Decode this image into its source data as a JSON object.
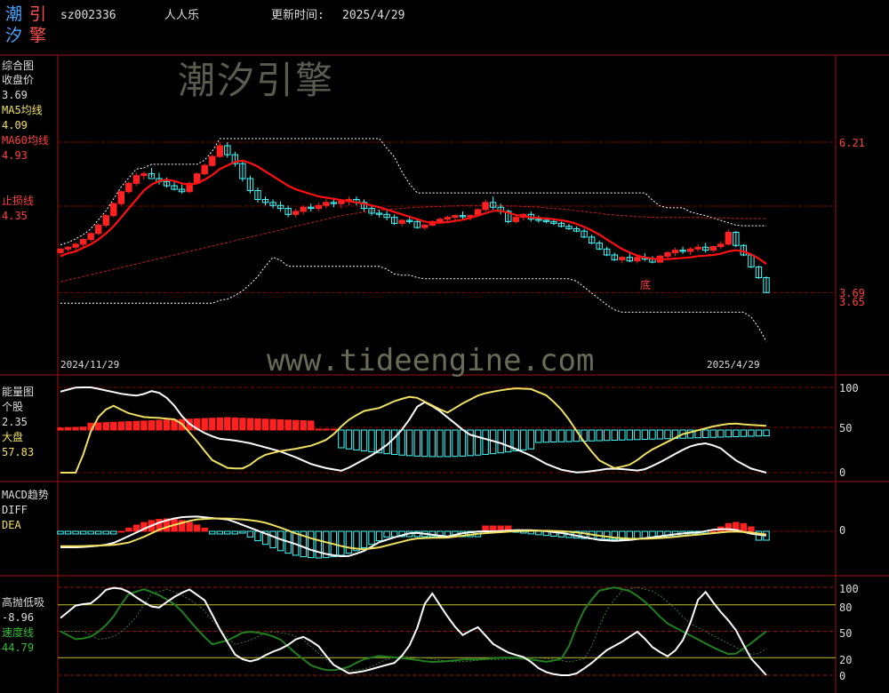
{
  "header": {
    "logo_chars": [
      "潮",
      "引",
      "汐",
      "擎"
    ],
    "code": "sz002336",
    "name": "人人乐",
    "update_label": "更新时间:",
    "update_date": "2025/4/29"
  },
  "watermarks": {
    "cn": "潮汐引擎",
    "url": "www.tideengine.com"
  },
  "colors": {
    "up": "#ff2020",
    "down": "#40ffff",
    "ma5": "#ff1010",
    "grid": "#8b0000",
    "yellow": "#f0e060",
    "white": "#ffffff",
    "green": "#208020"
  },
  "main_panel": {
    "title": "综合图",
    "close_label": "收盘价",
    "close_value": "3.69",
    "ma5_label": "MA5均线",
    "ma5_value": "4.09",
    "ma60_label": "MA60均线",
    "ma60_value": "4.93",
    "stop_label": "止损线",
    "stop_value": "4.35",
    "right_label_top": "6.21",
    "right_label_mid": "3.69",
    "right_label_low": "3.65",
    "start_date": "2024/11/29",
    "end_date": "2025/4/29",
    "bottom_mark": "底"
  },
  "energy_panel": {
    "title": "能量图",
    "stock_label": "个股",
    "stock_value": "2.35",
    "market_label": "大盘",
    "market_value": "57.83",
    "ticks": [
      "100",
      "50",
      "0"
    ]
  },
  "macd_panel": {
    "title": "MACD趋势",
    "diff_label": "DIFF",
    "dea_label": "DEA",
    "tick": "0"
  },
  "hl_panel": {
    "title": "高抛低吸",
    "value": "-8.96",
    "speed_label": "速度线",
    "speed_value": "44.79",
    "ticks": [
      "100",
      "80",
      "50",
      "20",
      "0"
    ]
  },
  "chart_data": {
    "type": "candlestick",
    "x_start": "2024/11/29",
    "x_end": "2025/4/29",
    "y_range": [
      3.65,
      6.21
    ],
    "candles": [
      [
        4.36,
        4.43,
        4.33,
        4.42
      ],
      [
        4.42,
        4.47,
        4.38,
        4.45
      ],
      [
        4.45,
        4.53,
        4.4,
        4.5
      ],
      [
        4.5,
        4.6,
        4.46,
        4.58
      ],
      [
        4.58,
        4.7,
        4.54,
        4.68
      ],
      [
        4.68,
        4.85,
        4.65,
        4.82
      ],
      [
        4.82,
        5.0,
        4.78,
        4.98
      ],
      [
        4.98,
        5.2,
        4.95,
        5.18
      ],
      [
        5.18,
        5.4,
        5.15,
        5.38
      ],
      [
        5.38,
        5.55,
        5.35,
        5.52
      ],
      [
        5.52,
        5.7,
        5.48,
        5.65
      ],
      [
        5.65,
        5.72,
        5.58,
        5.68
      ],
      [
        5.68,
        5.78,
        5.62,
        5.6
      ],
      [
        5.6,
        5.7,
        5.5,
        5.55
      ],
      [
        5.55,
        5.62,
        5.45,
        5.48
      ],
      [
        5.48,
        5.55,
        5.4,
        5.42
      ],
      [
        5.42,
        5.5,
        5.35,
        5.38
      ],
      [
        5.38,
        5.55,
        5.36,
        5.52
      ],
      [
        5.52,
        5.7,
        5.5,
        5.68
      ],
      [
        5.68,
        5.85,
        5.65,
        5.82
      ],
      [
        5.82,
        6.0,
        5.8,
        5.97
      ],
      [
        5.97,
        6.21,
        5.95,
        6.15
      ],
      [
        6.15,
        6.21,
        5.95,
        6.0
      ],
      [
        6.0,
        6.05,
        5.8,
        5.85
      ],
      [
        5.85,
        5.9,
        5.55,
        5.6
      ],
      [
        5.6,
        5.65,
        5.35,
        5.4
      ],
      [
        5.4,
        5.45,
        5.2,
        5.25
      ],
      [
        5.25,
        5.3,
        5.15,
        5.2
      ],
      [
        5.2,
        5.25,
        5.1,
        5.15
      ],
      [
        5.15,
        5.22,
        5.05,
        5.1
      ],
      [
        5.1,
        5.15,
        4.95,
        5.0
      ],
      [
        5.0,
        5.1,
        4.95,
        5.05
      ],
      [
        5.05,
        5.15,
        5.0,
        5.12
      ],
      [
        5.12,
        5.18,
        5.05,
        5.1
      ],
      [
        5.1,
        5.2,
        5.05,
        5.15
      ],
      [
        5.15,
        5.25,
        5.1,
        5.2
      ],
      [
        5.2,
        5.28,
        5.12,
        5.18
      ],
      [
        5.18,
        5.25,
        5.1,
        5.22
      ],
      [
        5.22,
        5.3,
        5.15,
        5.25
      ],
      [
        5.25,
        5.3,
        5.15,
        5.2
      ],
      [
        5.2,
        5.25,
        5.05,
        5.1
      ],
      [
        5.1,
        5.15,
        4.98,
        5.02
      ],
      [
        5.02,
        5.08,
        4.95,
        5.0
      ],
      [
        5.0,
        5.06,
        4.9,
        4.95
      ],
      [
        4.95,
        5.0,
        4.82,
        4.85
      ],
      [
        4.85,
        4.92,
        4.8,
        4.9
      ],
      [
        4.9,
        4.96,
        4.84,
        4.88
      ],
      [
        4.88,
        4.92,
        4.76,
        4.78
      ],
      [
        4.78,
        4.84,
        4.74,
        4.82
      ],
      [
        4.82,
        4.9,
        4.8,
        4.88
      ],
      [
        4.88,
        4.95,
        4.84,
        4.92
      ],
      [
        4.92,
        4.98,
        4.88,
        4.95
      ],
      [
        4.95,
        5.0,
        4.9,
        4.98
      ],
      [
        4.98,
        5.05,
        4.92,
        4.96
      ],
      [
        4.96,
        5.0,
        4.9,
        4.98
      ],
      [
        4.98,
        5.1,
        4.96,
        5.08
      ],
      [
        5.08,
        5.25,
        5.05,
        5.2
      ],
      [
        5.2,
        5.3,
        5.08,
        5.12
      ],
      [
        5.12,
        5.18,
        5.0,
        5.05
      ],
      [
        5.05,
        5.08,
        4.85,
        4.88
      ],
      [
        4.88,
        4.98,
        4.85,
        4.95
      ],
      [
        4.95,
        5.02,
        4.9,
        5.0
      ],
      [
        5.0,
        5.05,
        4.88,
        4.92
      ],
      [
        4.92,
        4.98,
        4.86,
        4.9
      ],
      [
        4.9,
        4.95,
        4.85,
        4.88
      ],
      [
        4.88,
        4.92,
        4.82,
        4.85
      ],
      [
        4.85,
        4.88,
        4.78,
        4.8
      ],
      [
        4.8,
        4.84,
        4.74,
        4.76
      ],
      [
        4.76,
        4.8,
        4.7,
        4.72
      ],
      [
        4.72,
        4.76,
        4.6,
        4.62
      ],
      [
        4.62,
        4.66,
        4.5,
        4.52
      ],
      [
        4.52,
        4.56,
        4.4,
        4.42
      ],
      [
        4.42,
        4.46,
        4.3,
        4.32
      ],
      [
        4.32,
        4.36,
        4.22,
        4.24
      ],
      [
        4.24,
        4.3,
        4.18,
        4.28
      ],
      [
        4.28,
        4.35,
        4.2,
        4.22
      ],
      [
        4.22,
        4.3,
        4.18,
        4.28
      ],
      [
        4.28,
        4.35,
        4.22,
        4.25
      ],
      [
        4.25,
        4.3,
        4.18,
        4.2
      ],
      [
        4.2,
        4.32,
        4.18,
        4.3
      ],
      [
        4.3,
        4.38,
        4.25,
        4.36
      ],
      [
        4.36,
        4.44,
        4.3,
        4.4
      ],
      [
        4.4,
        4.46,
        4.34,
        4.38
      ],
      [
        4.38,
        4.45,
        4.32,
        4.42
      ],
      [
        4.42,
        4.5,
        4.38,
        4.45
      ],
      [
        4.45,
        4.52,
        4.36,
        4.4
      ],
      [
        4.4,
        4.48,
        4.36,
        4.46
      ],
      [
        4.46,
        4.55,
        4.42,
        4.5
      ],
      [
        4.5,
        4.75,
        4.48,
        4.7
      ],
      [
        4.7,
        4.72,
        4.45,
        4.48
      ],
      [
        4.48,
        4.5,
        4.3,
        4.32
      ],
      [
        4.32,
        4.34,
        4.1,
        4.12
      ],
      [
        4.12,
        4.14,
        3.92,
        3.94
      ],
      [
        3.94,
        3.96,
        3.69,
        3.69
      ]
    ],
    "ma5": [
      4.3,
      4.35,
      4.38,
      4.44,
      4.5,
      4.58,
      4.68,
      4.8,
      4.95,
      5.1,
      5.25,
      5.4,
      5.5,
      5.56,
      5.58,
      5.56,
      5.52,
      5.5,
      5.52,
      5.58,
      5.66,
      5.76,
      5.82,
      5.88,
      5.9,
      5.86,
      5.8,
      5.72,
      5.64,
      5.56,
      5.48,
      5.42,
      5.38,
      5.34,
      5.3,
      5.28,
      5.26,
      5.24,
      5.22,
      5.2,
      5.18,
      5.15,
      5.12,
      5.08,
      5.04,
      5.0,
      4.96,
      4.92,
      4.88,
      4.86,
      4.86,
      4.87,
      4.89,
      4.91,
      4.94,
      4.98,
      5.02,
      5.06,
      5.06,
      5.03,
      4.99,
      4.97,
      4.95,
      4.94,
      4.93,
      4.92,
      4.9,
      4.88,
      4.84,
      4.79,
      4.73,
      4.66,
      4.58,
      4.5,
      4.42,
      4.36,
      4.31,
      4.28,
      4.26,
      4.25,
      4.25,
      4.26,
      4.27,
      4.28,
      4.3,
      4.31,
      4.32,
      4.34,
      4.38,
      4.4,
      4.38,
      4.33,
      4.26,
      4.17
    ],
    "ma60": [
      3.87,
      3.9,
      3.93,
      3.96,
      3.99,
      4.02,
      4.05,
      4.08,
      4.11,
      4.14,
      4.17,
      4.2,
      4.23,
      4.26,
      4.29,
      4.32,
      4.35,
      4.38,
      4.41,
      4.44,
      4.47,
      4.5,
      4.53,
      4.56,
      4.59,
      4.62,
      4.65,
      4.68,
      4.71,
      4.74,
      4.77,
      4.8,
      4.83,
      4.86,
      4.89,
      4.92,
      4.95,
      4.98,
      5.0,
      5.02,
      5.04,
      5.06,
      5.07,
      5.08,
      5.09,
      5.1,
      5.11,
      5.12,
      5.12,
      5.13,
      5.13,
      5.14,
      5.14,
      5.15,
      5.15,
      5.15,
      5.15,
      5.15,
      5.15,
      5.14,
      5.14,
      5.13,
      5.13,
      5.12,
      5.11,
      5.1,
      5.09,
      5.08,
      5.06,
      5.05,
      5.03,
      5.02,
      5.0,
      4.99,
      4.98,
      4.97,
      4.96,
      4.96,
      4.95,
      4.95,
      4.95,
      4.95,
      4.95,
      4.95,
      4.95,
      4.94,
      4.94,
      4.94,
      4.94,
      4.93,
      4.93,
      4.93,
      4.93,
      4.93
    ]
  }
}
